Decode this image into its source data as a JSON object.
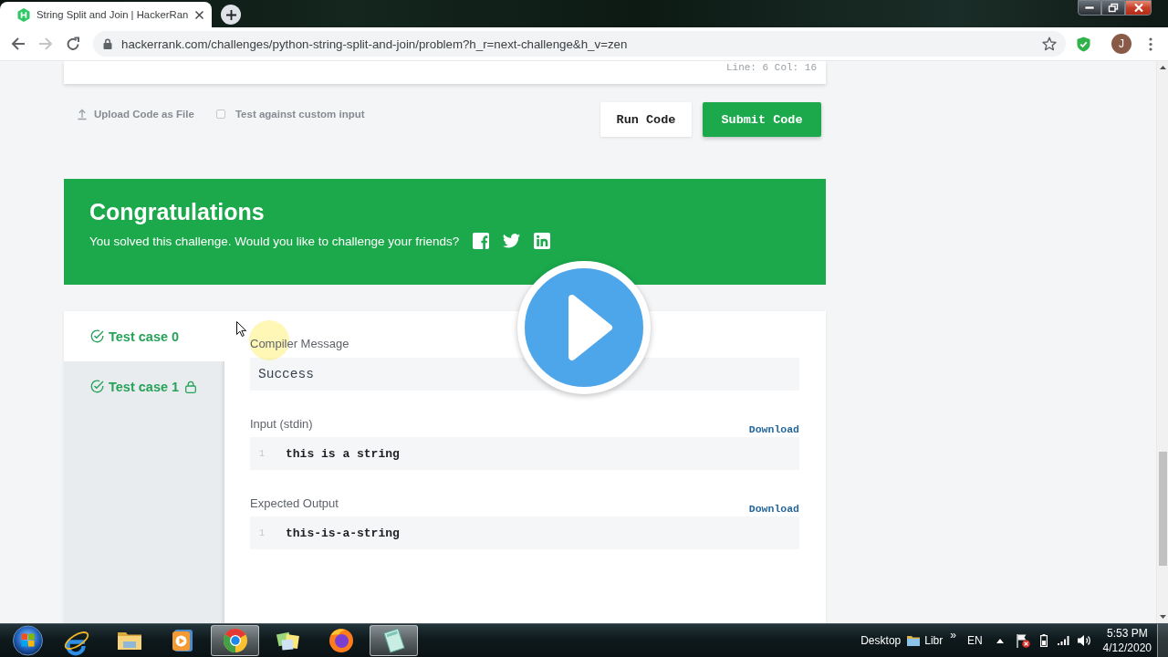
{
  "browser": {
    "tab": {
      "title": "String Split and Join | HackerRan"
    },
    "nav": [
      {
        "kind": "back",
        "disabled": false
      },
      {
        "kind": "forward",
        "disabled": true
      },
      {
        "kind": "reload",
        "disabled": false
      }
    ],
    "url": "hackerrank.com/challenges/python-string-split-and-join/problem?h_r=next-challenge&h_v=zen",
    "profile_initial": "J"
  },
  "editor": {
    "cursor_position": "Line: 6 Col: 16"
  },
  "actions": {
    "upload_label": "Upload Code as File",
    "custom_input": {
      "label": "Test against custom input",
      "checked": false
    },
    "buttons": [
      {
        "label": "Run Code",
        "kind": "run"
      },
      {
        "label": "Submit Code",
        "kind": "submit"
      }
    ]
  },
  "banner": {
    "title": "Congratulations",
    "message": "You solved this challenge. Would you like to challenge your friends?"
  },
  "test_cases": [
    {
      "label": "Test case 0",
      "selected": true,
      "passed": true,
      "locked": false
    },
    {
      "label": "Test case 1",
      "selected": false,
      "passed": true,
      "locked": true
    }
  ],
  "result": {
    "compiler_message": {
      "label": "Compiler Message",
      "value": "Success"
    },
    "sections": [
      {
        "label": "Input (stdin)",
        "action": "Download",
        "lines": [
          {
            "number": "1",
            "text": "this is a string"
          }
        ]
      },
      {
        "label": "Expected Output",
        "action": "Download",
        "lines": [
          {
            "number": "1",
            "text": "this-is-a-string"
          }
        ]
      }
    ]
  },
  "taskbar": {
    "apps": [
      {
        "kind": "globe",
        "active": false
      },
      {
        "kind": "folder",
        "active": false
      },
      {
        "kind": "player",
        "active": false
      },
      {
        "kind": "wheel",
        "active": true
      },
      {
        "kind": "notes",
        "active": false
      },
      {
        "kind": "fox",
        "active": false
      },
      {
        "kind": "pad",
        "active": true
      }
    ],
    "toolbars": [
      {
        "label": "Desktop",
        "kind": "text"
      },
      {
        "label": "Libr",
        "kind": "folder"
      }
    ],
    "overflow": "»",
    "language": "EN",
    "time": "5:53 PM",
    "date": "4/12/2020"
  }
}
